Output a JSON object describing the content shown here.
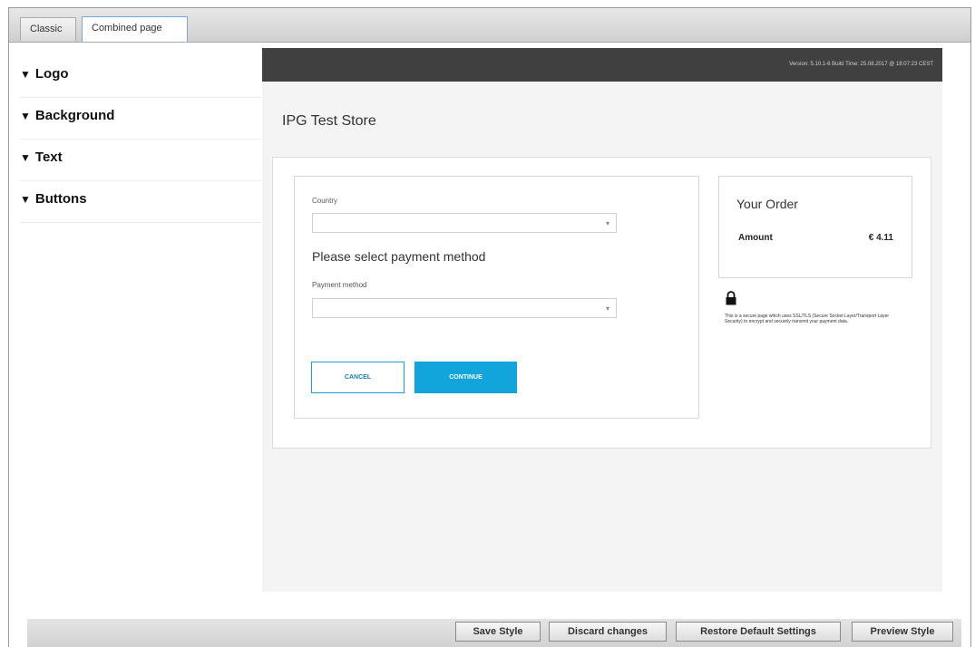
{
  "tabs": [
    {
      "label": "Classic",
      "active": false
    },
    {
      "label": "Combined page",
      "active": true
    }
  ],
  "sidebar": {
    "sections": [
      {
        "label": "Logo"
      },
      {
        "label": "Background"
      },
      {
        "label": "Text"
      },
      {
        "label": "Buttons"
      }
    ]
  },
  "preview": {
    "version_text": "Version: 5.10.1-6 Build Time: 25.08.2017 @ 18:07:23 CEST",
    "store_title": "IPG Test Store",
    "form": {
      "country_label": "Country",
      "country_value": "",
      "payment_heading": "Please select payment method",
      "payment_method_label": "Payment method",
      "payment_method_value": "",
      "cancel_label": "CANCEL",
      "continue_label": "CONTINUE"
    },
    "order": {
      "title": "Your Order",
      "amount_label": "Amount",
      "amount_value": "€ 4.11"
    },
    "secure_text": "This is a secure page which uses SSL/TLS (Secure Socket Layer/Transport Layer Security) to encrypt and securely transmit your payment data."
  },
  "footer": {
    "save_label": "Save Style",
    "discard_label": "Discard changes",
    "restore_label": "Restore Default Settings",
    "preview_label": "Preview Style"
  },
  "colors": {
    "accent": "#12a5dc",
    "version_bar": "#404040",
    "preview_bg": "#f4f4f4"
  }
}
